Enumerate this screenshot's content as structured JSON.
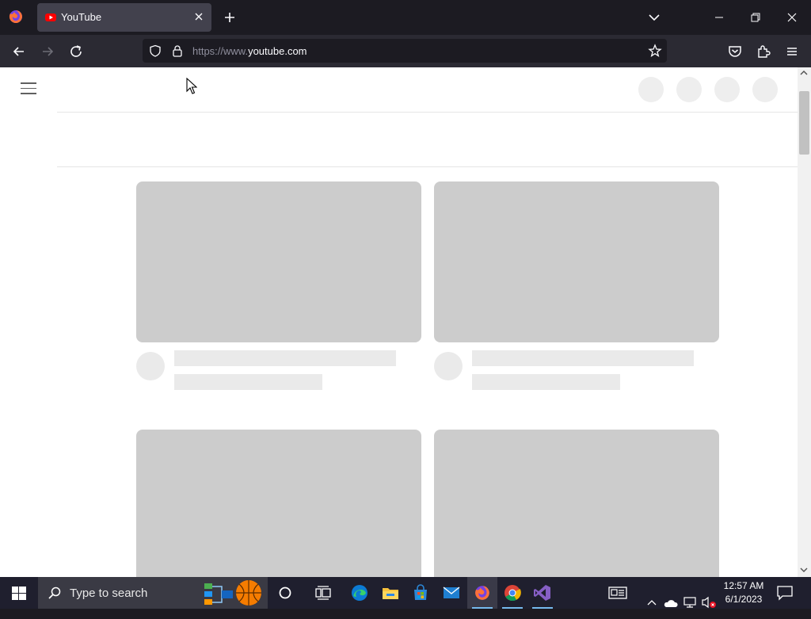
{
  "browser": {
    "tab": {
      "title": "YouTube"
    },
    "url": {
      "prefix": "https://www.",
      "host": "youtube.com"
    }
  },
  "taskbar": {
    "search_placeholder": "Type to search",
    "time": "12:57 AM",
    "date": "6/1/2023"
  },
  "colors": {
    "accent": "#76b9ed",
    "youtube_red": "#ff0000",
    "skeleton_thumb": "#cccccc",
    "skeleton_text": "#eaeaea"
  },
  "icons": [
    "firefox-icon",
    "youtube-favicon-icon",
    "close-icon",
    "plus-icon",
    "chevron-down-icon",
    "minimize-icon",
    "restore-icon",
    "back-arrow-icon",
    "forward-arrow-icon",
    "reload-icon",
    "shield-icon",
    "lock-icon",
    "star-icon",
    "pocket-icon",
    "extensions-icon",
    "menu-icon",
    "hamburger-icon",
    "windows-icon",
    "search-icon",
    "cortana-icon",
    "task-view-icon",
    "edge-icon",
    "file-explorer-icon",
    "store-icon",
    "mail-icon",
    "chrome-icon",
    "visual-studio-icon",
    "news-icon",
    "onedrive-icon",
    "network-icon",
    "volume-muted-icon",
    "notification-icon"
  ]
}
